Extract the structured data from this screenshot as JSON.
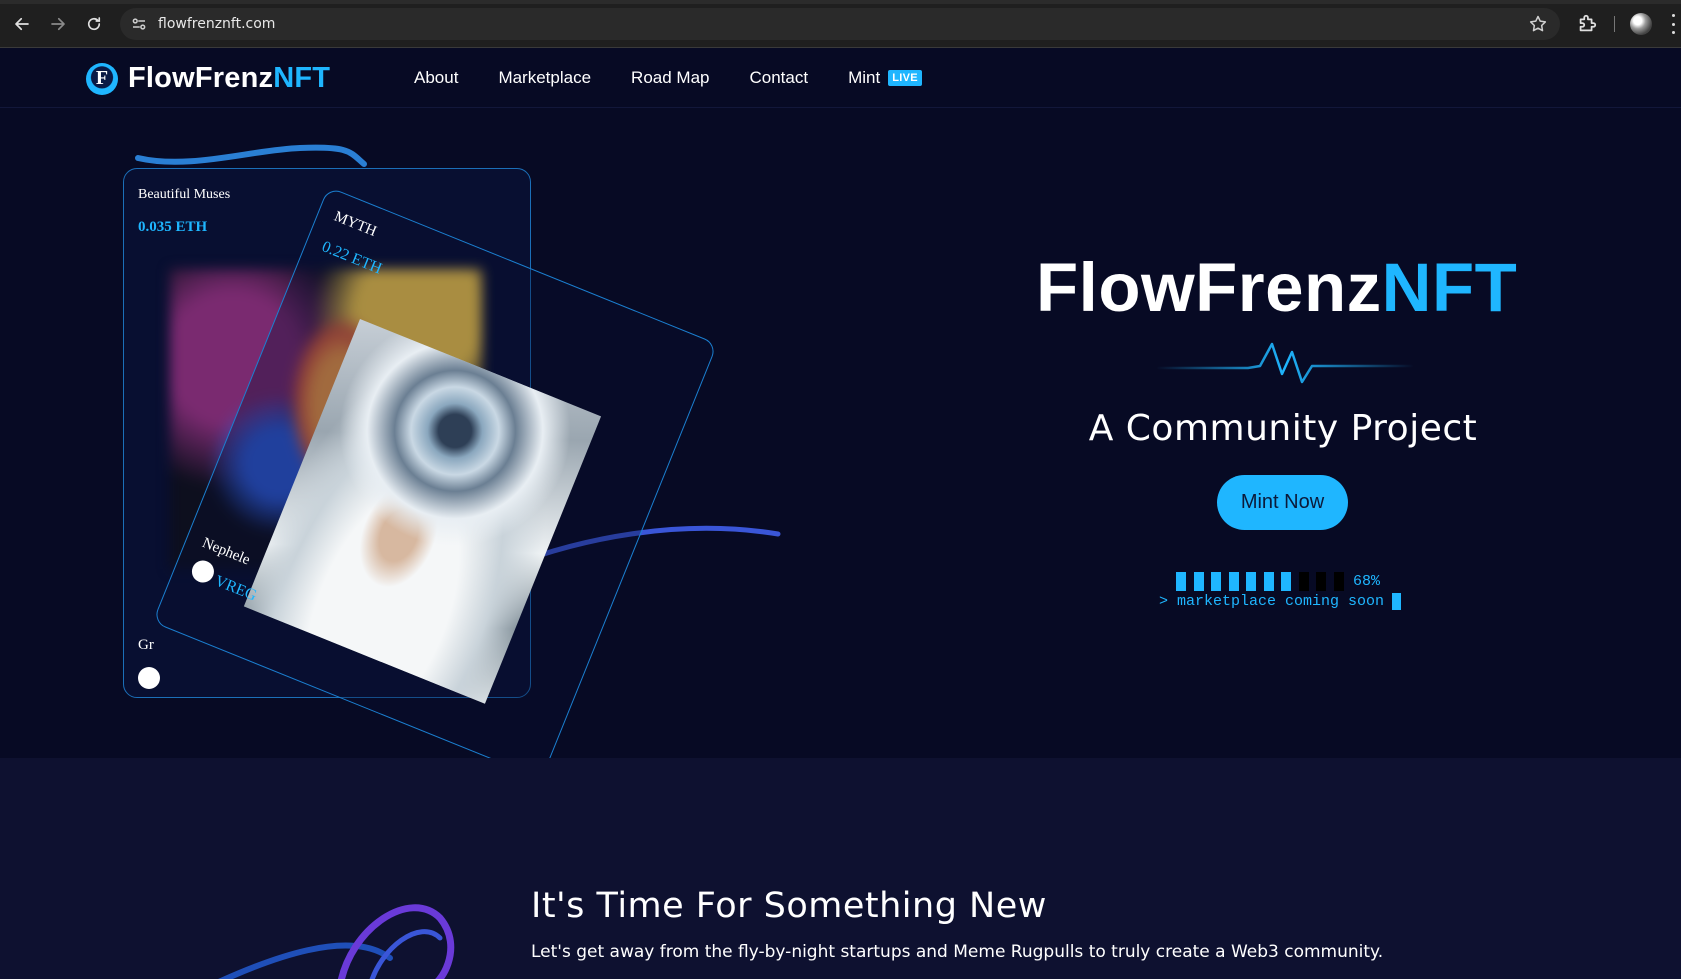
{
  "browser": {
    "url": "flowfrenznft.com",
    "icons": {
      "back": "back-arrow-icon",
      "forward": "forward-arrow-icon",
      "reload": "reload-icon",
      "site_info": "site-settings-icon",
      "bookmark": "bookmark-star-icon",
      "extensions": "extensions-puzzle-icon",
      "profile": "profile-avatar",
      "menu": "kebab-menu-icon"
    }
  },
  "header": {
    "logo_main": "FlowFrenz",
    "logo_accent": "NFT",
    "logo_glyph": "F",
    "nav": {
      "about": "About",
      "marketplace": "Marketplace",
      "roadmap": "Road Map",
      "contact": "Contact",
      "mint": "Mint",
      "mint_badge": "LIVE"
    }
  },
  "hero": {
    "card_back": {
      "title": "Beautiful Muses",
      "price": "0.035 ETH",
      "bottom_label": "Gr"
    },
    "card_front": {
      "title": "MYTH",
      "price": "0.22 ETH",
      "name": "Nephele",
      "code": "VREG"
    },
    "title_main": "FlowFrenz",
    "title_accent": "NFT",
    "tagline": "A Community Project",
    "mint_button": "Mint Now",
    "progress": {
      "percent_label": "68%",
      "value": 0.68,
      "segments_total": 10,
      "segments_filled": 7
    },
    "terminal_text": "> marketplace coming soon"
  },
  "section2": {
    "title": "It's Time For Something New",
    "text": "Let's get away from the fly-by-night startups and Meme Rugpulls to truly create a Web3 community."
  },
  "colors": {
    "background": "#070a24",
    "section_bg": "#0e1130",
    "accent": "#1fb6ff",
    "text": "#ffffff"
  }
}
